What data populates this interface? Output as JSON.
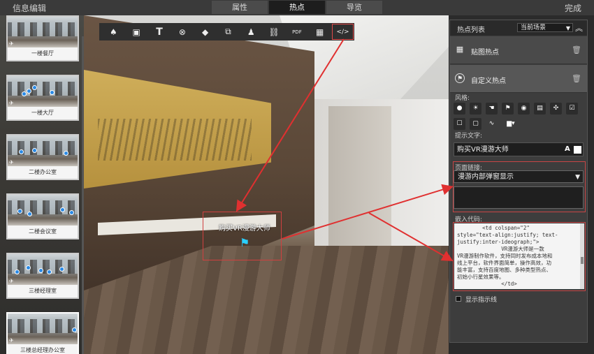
{
  "app": {
    "title": "信息编辑",
    "done_label": "完成"
  },
  "tabs": [
    {
      "label": "属性"
    },
    {
      "label": "热点"
    },
    {
      "label": "导览"
    }
  ],
  "scenes": [
    {
      "label": "一楼餐厅"
    },
    {
      "label": "一楼大厅"
    },
    {
      "label": "二楼办公室"
    },
    {
      "label": "二楼会议室"
    },
    {
      "label": "三楼经理室"
    },
    {
      "label": "三楼总经理办公室"
    }
  ],
  "toolbar": {
    "icons": [
      "tree-icon",
      "image-icon",
      "text-icon",
      "video-icon",
      "cube-icon",
      "window-icon",
      "stamp-icon",
      "link-icon",
      "pdf-icon",
      "gallery-icon",
      "code-icon"
    ]
  },
  "viewport": {
    "hotspot_text": "购买VR漫游大师"
  },
  "panel": {
    "title": "热点列表",
    "scene_filter": "当前场景",
    "items": [
      {
        "label": "贴图热点"
      },
      {
        "label": "自定义热点"
      }
    ],
    "style_label": "风格:",
    "tip_label": "提示文字:",
    "tip_value": "购买VR漫游大师",
    "font_label": "A",
    "link_label": "页面链接:",
    "link_value": "漫游内部弹窗显示",
    "embed_label": "嵌入代码:",
    "embed_code": "        <td colspan=\"2\"\nstyle=\"text-align:justify; text-\njustify:inter-ideograph;\">\n              VR漫游大师是一款\nVR漫游制作软件，支持同时发布成本地和\n线上平台，软件界面简单，操作高效，功\n能丰富，支持百度地图、多种类型热点、\n初始小行星效果等。\n              </td>",
    "show_indicator_label": "显示指示线"
  },
  "colors": {
    "accent_red": "#d04040",
    "hotspot_blue": "#2a8ae6"
  }
}
